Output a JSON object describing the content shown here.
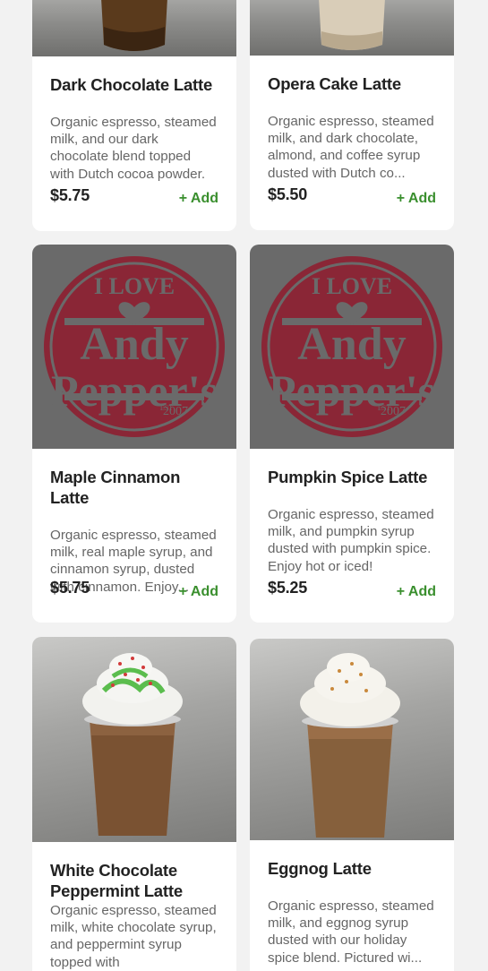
{
  "currency": "$",
  "add_label": "+ Add",
  "colors": {
    "accent_green": "#3a8f2e",
    "logo_red": "#8f2737",
    "card_bg": "#ffffff"
  },
  "items": [
    {
      "title": "Dark Chocolate Latte",
      "description": "Organic espresso, steamed milk, and our dark chocolate blend topped with Dutch cocoa powder. Enjoy...",
      "price": "5.75",
      "image": "drink-photo"
    },
    {
      "title": "Opera Cake Latte",
      "description": "Organic espresso, steamed milk, and dark chocolate, almond, and coffee syrup dusted with Dutch co...",
      "price": "5.50",
      "image": "drink-photo"
    },
    {
      "title": "Maple Cinnamon Latte",
      "description": "Organic espresso, steamed milk, real maple syrup, and cinnamon syrup, dusted with cinnamon. Enjoy...",
      "price": "5.75",
      "image": "andy-peppers-logo"
    },
    {
      "title": "Pumpkin Spice Latte",
      "description": "Organic espresso, steamed milk, and pumpkin syrup dusted with pumpkin spice. Enjoy hot or iced!",
      "price": "5.25",
      "image": "andy-peppers-logo"
    },
    {
      "title": "White Chocolate Peppermint Latte",
      "description": "Organic espresso, steamed milk, white chocolate syrup, and peppermint syrup topped with",
      "price": "",
      "image": "drink-photo"
    },
    {
      "title": "Eggnog Latte",
      "description": "Organic espresso, steamed milk, and eggnog syrup dusted with our holiday spice blend. Pictured wi...",
      "price": "",
      "image": "drink-photo"
    }
  ],
  "logo": {
    "top_text": "I LOVE",
    "line1": "Andy",
    "line2": "Pepper's",
    "est": "EST",
    "year": "2007"
  }
}
